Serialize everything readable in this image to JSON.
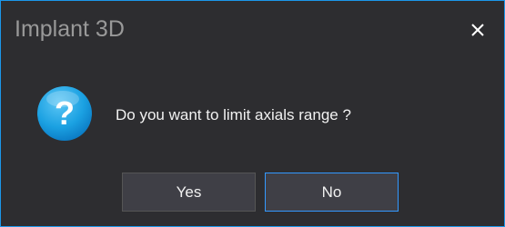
{
  "window": {
    "title": "Implant 3D",
    "close_glyph": "✕"
  },
  "dialog": {
    "icon": "question-icon",
    "icon_glyph": "?",
    "message": "Do you want to limit axials range ?",
    "buttons": {
      "yes_label": "Yes",
      "no_label": "No",
      "focused": "No"
    }
  },
  "colors": {
    "background": "#2d2d30",
    "border_accent": "#1c97ea",
    "title_text": "#999999",
    "button_bg": "#3f3f46",
    "focus_border": "#3399ff",
    "icon_blue": "#1ba1e2"
  }
}
